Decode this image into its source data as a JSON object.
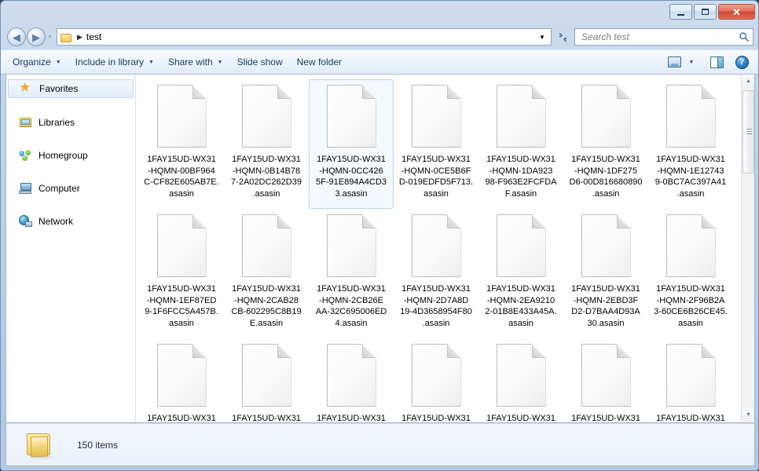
{
  "window": {
    "controls": {
      "minimize_label": "Minimize",
      "maximize_label": "Maximize",
      "close_label": "Close",
      "close_glyph": "✕"
    }
  },
  "address_bar": {
    "back_label": "Back",
    "forward_label": "Forward",
    "back_glyph": "◀",
    "forward_glyph": "▶",
    "recent_pages_glyph": "▼",
    "folder_icon": "folder-icon",
    "separator_glyph": "▶",
    "path": "test",
    "dropdown_glyph": "▼",
    "refresh_label": "Refresh",
    "refresh_glyph": "↻"
  },
  "search": {
    "placeholder": "Search test",
    "icon": "search-icon"
  },
  "toolbar": {
    "items": [
      {
        "label": "Organize",
        "has_caret": true
      },
      {
        "label": "Include in library",
        "has_caret": true
      },
      {
        "label": "Share with",
        "has_caret": true
      },
      {
        "label": "Slide show",
        "has_caret": false
      },
      {
        "label": "New folder",
        "has_caret": false
      }
    ],
    "caret_glyph": "▼",
    "view_button_label": "Change your view",
    "view_caret_glyph": "▼",
    "preview_pane_label": "Show the preview pane",
    "help_label": "Get help",
    "help_glyph": "?"
  },
  "sidebar": {
    "items": [
      {
        "label": "Favorites",
        "icon": "star-icon",
        "selected": true
      },
      {
        "label": "Libraries",
        "icon": "library-icon",
        "selected": false
      },
      {
        "label": "Homegroup",
        "icon": "homegroup-icon",
        "selected": false
      },
      {
        "label": "Computer",
        "icon": "computer-icon",
        "selected": false
      },
      {
        "label": "Network",
        "icon": "network-icon",
        "selected": false
      }
    ],
    "star_glyph": "★"
  },
  "files": [
    {
      "name": "1FAY15UD-WX31-HQMN-00BF964C-CF82E605AB7E.asasin",
      "display": "1FAY15UD-WX31\n-HQMN-00BF964\nC-CF82E605AB7E.\nasasin",
      "selected": false,
      "truncated": false
    },
    {
      "name": "1FAY15UD-WX31-HQMN-0B14B787-2A02DC262D39.asasin",
      "display": "1FAY15UD-WX31\n-HQMN-0B14B78\n7-2A02DC262D39\n.asasin",
      "selected": false,
      "truncated": false
    },
    {
      "name": "1FAY15UD-WX31-HQMN-0CC4265F-91E894A4CD33.asasin",
      "display": "1FAY15UD-WX31\n-HQMN-0CC426\n5F-91E894A4CD3\n3.asasin",
      "selected": true,
      "truncated": false
    },
    {
      "name": "1FAY15UD-WX31-HQMN-0CE5B6FD-019EDFD5F713.asasin",
      "display": "1FAY15UD-WX31\n-HQMN-0CE5B6F\nD-019EDFD5F713.\nasasin",
      "selected": false,
      "truncated": false
    },
    {
      "name": "1FAY15UD-WX31-HQMN-1DA92398-F963E2FCFDAF.asasin",
      "display": "1FAY15UD-WX31\n-HQMN-1DA923\n98-F963E2FCFDA\nF.asasin",
      "selected": false,
      "truncated": false
    },
    {
      "name": "1FAY15UD-WX31-HQMN-1DF275D6-00D816680890.asasin",
      "display": "1FAY15UD-WX31\n-HQMN-1DF275\nD6-00D816680890\n.asasin",
      "selected": false,
      "truncated": false
    },
    {
      "name": "1FAY15UD-WX31-HQMN-1E127439-0BC7AC397A41.asasin",
      "display": "1FAY15UD-WX31\n-HQMN-1E12743\n9-0BC7AC397A41\n.asasin",
      "selected": false,
      "truncated": false
    },
    {
      "name": "1FAY15UD-WX31-HQMN-1EF87ED9-1F6FCC5A457B.asasin",
      "display": "1FAY15UD-WX31\n-HQMN-1EF87ED\n9-1F6FCC5A457B.\nasasin",
      "selected": false,
      "truncated": false
    },
    {
      "name": "1FAY15UD-WX31-HQMN-2CAB28CB-602295C8B19E.asasin",
      "display": "1FAY15UD-WX31\n-HQMN-2CAB28\nCB-602295C8B19\nE.asasin",
      "selected": false,
      "truncated": false
    },
    {
      "name": "1FAY15UD-WX31-HQMN-2CB26EAA-32C695006ED4.asasin",
      "display": "1FAY15UD-WX31\n-HQMN-2CB26E\nAA-32C695006ED\n4.asasin",
      "selected": false,
      "truncated": false
    },
    {
      "name": "1FAY15UD-WX31-HQMN-2D7A8D19-4D3658954F80.asasin",
      "display": "1FAY15UD-WX31\n-HQMN-2D7A8D\n19-4D3658954F80\n.asasin",
      "selected": false,
      "truncated": false
    },
    {
      "name": "1FAY15UD-WX31-HQMN-2EA92102-01B8E433A45A.asasin",
      "display": "1FAY15UD-WX31\n-HQMN-2EA9210\n2-01B8E433A45A.\nasasin",
      "selected": false,
      "truncated": false
    },
    {
      "name": "1FAY15UD-WX31-HQMN-2EBD3FD2-D7BAA4D93A30.asasin",
      "display": "1FAY15UD-WX31\n-HQMN-2EBD3F\nD2-D7BAA4D93A\n30.asasin",
      "selected": false,
      "truncated": false
    },
    {
      "name": "1FAY15UD-WX31-HQMN-2F96B2A3-60CE6B26CE45.asasin",
      "display": "1FAY15UD-WX31\n-HQMN-2F96B2A\n3-60CE6B26CE45.\nasasin",
      "selected": false,
      "truncated": false
    },
    {
      "name": "1FAY15UD-WX31",
      "display": "1FAY15UD-WX31",
      "selected": false,
      "truncated": true
    },
    {
      "name": "1FAY15UD-WX31",
      "display": "1FAY15UD-WX31",
      "selected": false,
      "truncated": true
    },
    {
      "name": "1FAY15UD-WX31",
      "display": "1FAY15UD-WX31",
      "selected": false,
      "truncated": true
    },
    {
      "name": "1FAY15UD-WX31",
      "display": "1FAY15UD-WX31",
      "selected": false,
      "truncated": true
    },
    {
      "name": "1FAY15UD-WX31",
      "display": "1FAY15UD-WX31",
      "selected": false,
      "truncated": true
    },
    {
      "name": "1FAY15UD-WX31",
      "display": "1FAY15UD-WX31",
      "selected": false,
      "truncated": true
    },
    {
      "name": "1FAY15UD-WX31",
      "display": "1FAY15UD-WX31",
      "selected": false,
      "truncated": true
    }
  ],
  "scrollbar": {
    "up_glyph": "▲",
    "down_glyph": "▼"
  },
  "status_bar": {
    "folder_icon": "folder-icon",
    "text": "150 items"
  },
  "colors": {
    "selection_border": "#b8d6ee",
    "selection_fill": "#f4f9fd",
    "close_button": "#cf4a33",
    "accent": "#2f7fc4"
  }
}
